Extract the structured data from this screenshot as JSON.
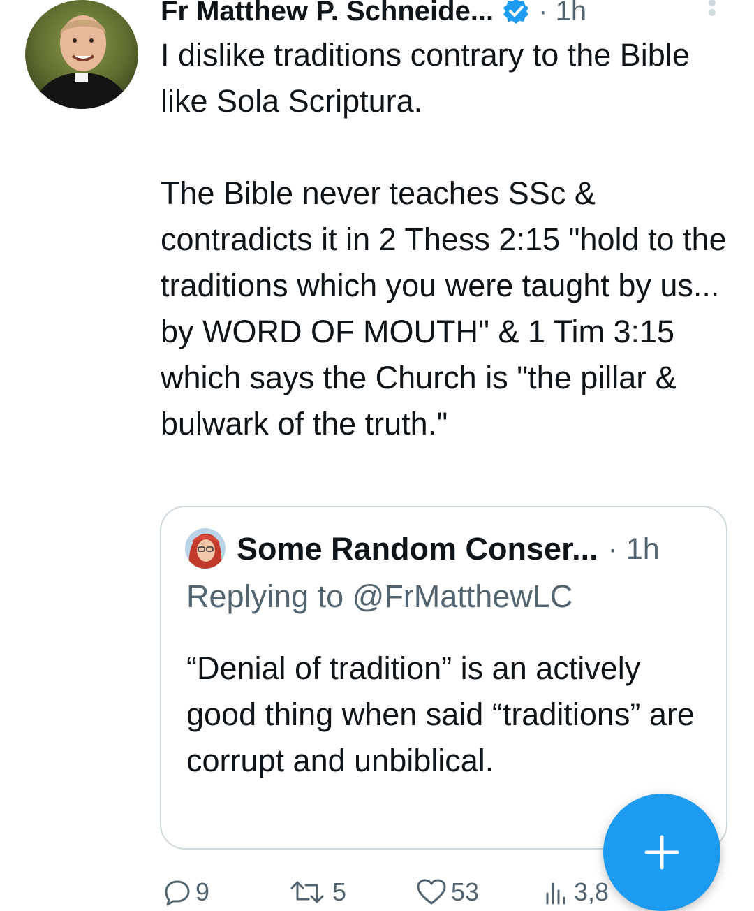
{
  "tweet": {
    "author_name": "Fr Matthew P. Schneide...",
    "time": "· 1h",
    "verified": true,
    "text": "I dislike traditions contrary to the Bible like Sola Scriptura.\n\nThe Bible never teaches SSc & contradicts it in 2 Thess 2:15 \"hold to the traditions which you were taught by us... by WORD OF MOUTH\" & 1 Tim 3:15 which says the Church is \"the pillar & bulwark of the truth.\""
  },
  "quote": {
    "author_name": "Some Random Conser...",
    "time": "· 1h",
    "replying_to": "Replying to @FrMatthewLC",
    "text": "“Denial of tradition” is an actively good thing when said “traditions” are corrupt and unbiblical."
  },
  "actions": {
    "replies": "9",
    "retweets": "5",
    "likes": "53",
    "views": "3,8"
  },
  "colors": {
    "accent": "#1d9bf0",
    "text": "#0f1419",
    "secondary": "#536471",
    "border": "#cfd9de"
  },
  "icons": [
    "verified-badge-icon",
    "more-icon",
    "reply-icon",
    "retweet-icon",
    "like-icon",
    "views-icon",
    "compose-plus-icon"
  ]
}
